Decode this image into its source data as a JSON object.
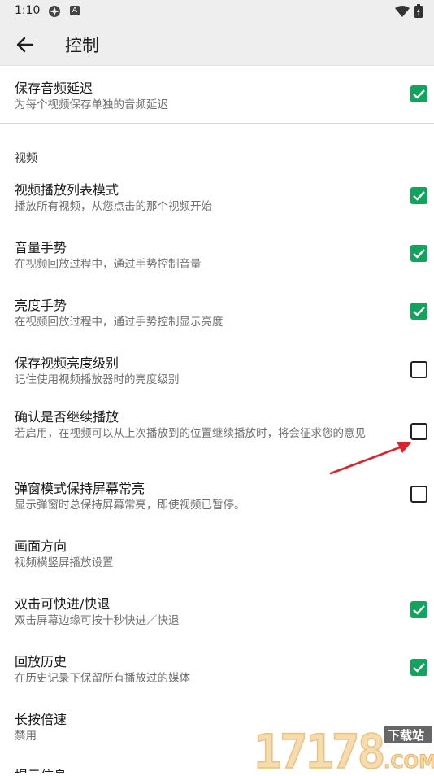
{
  "status": {
    "time": "1:10",
    "a_icon_letter": "A",
    "icons": [
      "settings-icon",
      "a-icon",
      "wifi-icon",
      "battery-icon"
    ]
  },
  "appbar": {
    "title": "控制",
    "back_icon": "arrow-left-icon"
  },
  "colors": {
    "accent": "#12a35e",
    "header_bg": "#eeeeee",
    "arrow": "#d6252c"
  },
  "items_top": [
    {
      "title": "保存音频延迟",
      "subtitle": "为每个视频保存单独的音频延迟",
      "checked": true
    }
  ],
  "section_video": "视频",
  "items": [
    {
      "title": "视频播放列表模式",
      "subtitle": "播放所有视频，从您点击的那个视频开始",
      "checked": true
    },
    {
      "title": "音量手势",
      "subtitle": "在视频回放过程中，通过手势控制音量",
      "checked": true
    },
    {
      "title": "亮度手势",
      "subtitle": "在视频回放过程中，通过手势控制显示亮度",
      "checked": true
    },
    {
      "title": "保存视频亮度级别",
      "subtitle": "记住使用视频播放器时的亮度级别",
      "checked": false
    },
    {
      "title": "确认是否继续播放",
      "subtitle": "若启用，在视频可以从上次播放到的位置继续播放时，将会征求您的意见",
      "checked": false
    },
    {
      "title": "弹窗模式保持屏幕常亮",
      "subtitle": "显示弹窗时总保持屏幕常亮，即使视频已暂停。",
      "checked": false
    },
    {
      "title": "画面方向",
      "subtitle": "视频横竖屏播放设置"
    },
    {
      "title": "双击可快进/快退",
      "subtitle": "双击屏幕边缘可按十秒快进／快退",
      "checked": true
    },
    {
      "title": "回放历史",
      "subtitle": "在历史记录下保留所有播放过的媒体",
      "checked": true
    },
    {
      "title": "长按倍速",
      "subtitle": "禁用"
    },
    {
      "title": "提示信息",
      "subtitle": ""
    }
  ],
  "watermark": {
    "number": "17178",
    "badge": "下载站",
    "domain": ".COM"
  }
}
